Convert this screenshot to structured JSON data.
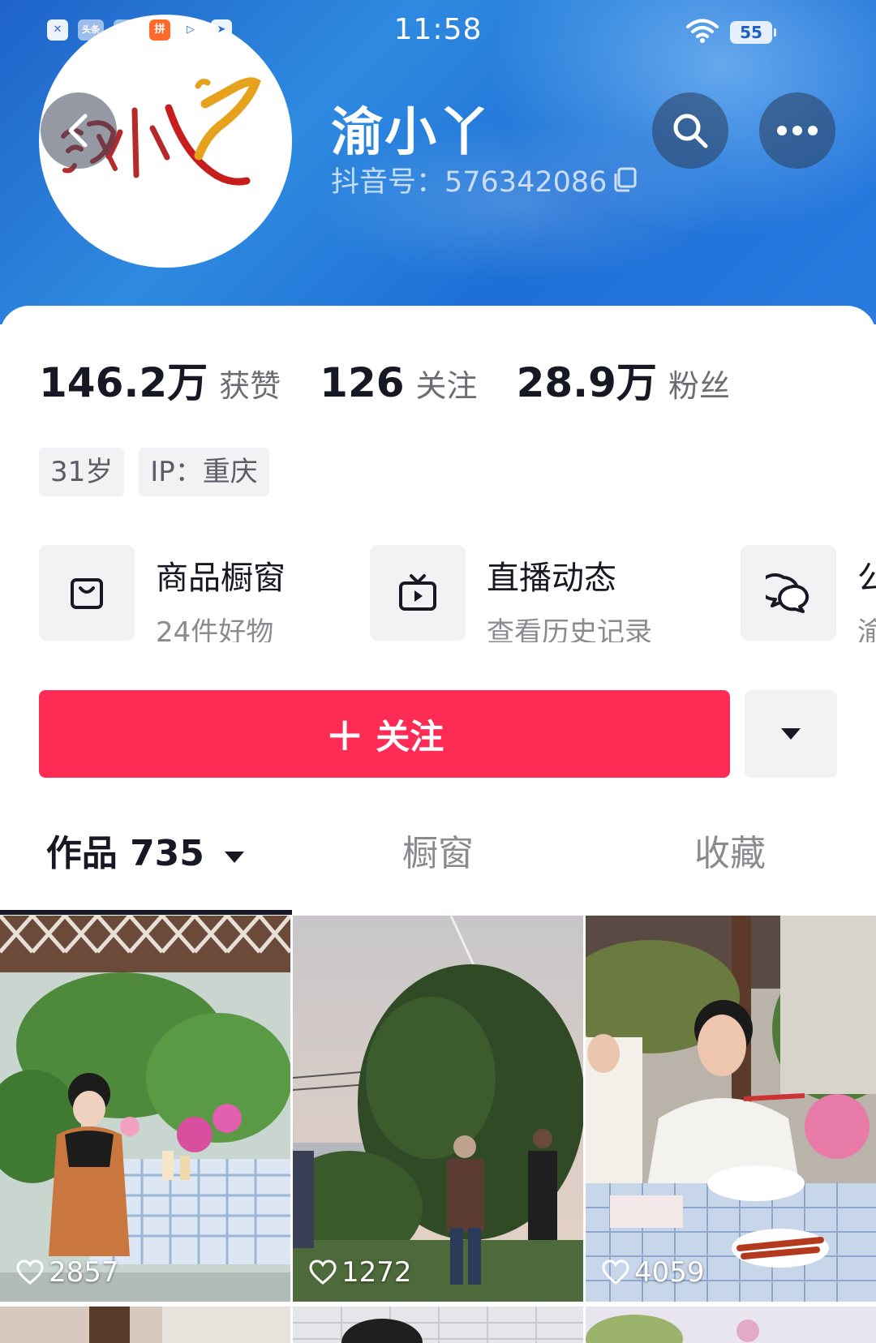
{
  "status_bar": {
    "time": "11:58",
    "battery": "55",
    "apps": [
      "✕",
      "头条",
      "头条",
      "拼",
      "▷",
      "➤"
    ]
  },
  "profile": {
    "name": "渝小丫",
    "douyin_id": "抖音号：576342086",
    "avatar_text": "渝小丫"
  },
  "stats": [
    {
      "value": "146.2万",
      "label": "获赞"
    },
    {
      "value": "126",
      "label": "关注"
    },
    {
      "value": "28.9万",
      "label": "粉丝"
    }
  ],
  "tags": [
    "31岁",
    "IP：重庆"
  ],
  "features": [
    {
      "title": "商品橱窗",
      "subtitle": "24件好物"
    },
    {
      "title": "直播动态",
      "subtitle": "查看历史记录"
    },
    {
      "title": "公",
      "subtitle": "渝"
    }
  ],
  "follow_button": {
    "icon": "+",
    "label": "关注"
  },
  "tabs": [
    {
      "label": "作品 735",
      "active": true
    },
    {
      "label": "橱窗",
      "active": false
    },
    {
      "label": "收藏",
      "active": false
    }
  ],
  "videos": [
    {
      "likes": "2857"
    },
    {
      "likes": "1272"
    },
    {
      "likes": "4059"
    }
  ],
  "colors": {
    "accent": "#fe2c55",
    "header_blue": "#1f63c9"
  }
}
